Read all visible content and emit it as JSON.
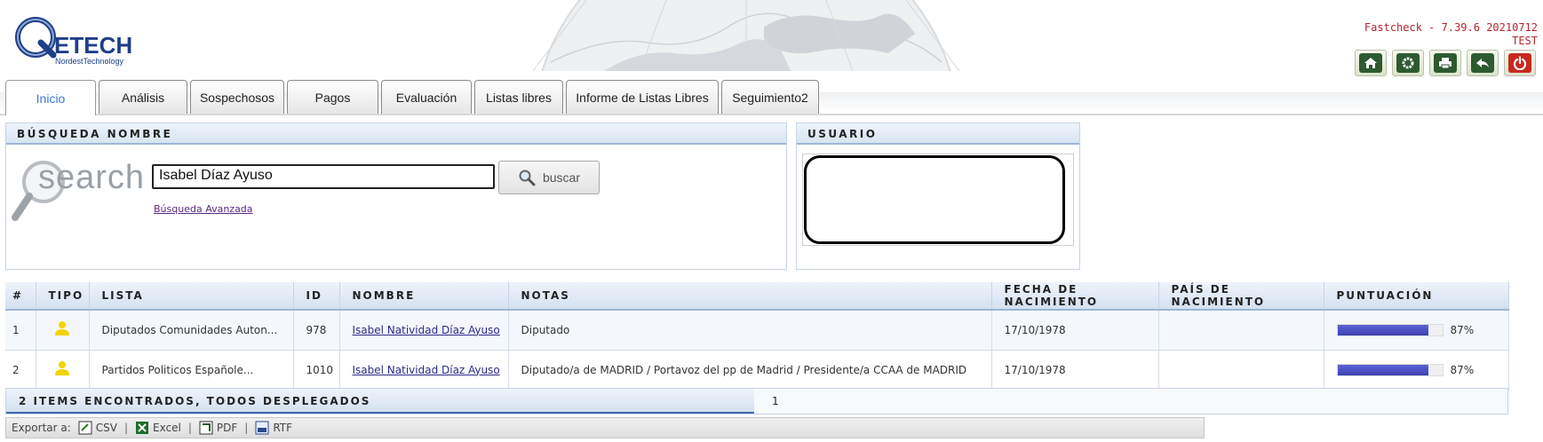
{
  "header": {
    "logo_text": "ETECH",
    "logo_sub": "NordestTechnology",
    "version": "Fastcheck - 7.39.6 20210712",
    "environment": "TEST",
    "toolbar": [
      {
        "icon": "home-icon"
      },
      {
        "icon": "gear-icon"
      },
      {
        "icon": "print-icon"
      },
      {
        "icon": "back-icon"
      },
      {
        "icon": "power-icon"
      }
    ]
  },
  "tabs": [
    {
      "label": "Inicio",
      "active": true
    },
    {
      "label": "Análisis"
    },
    {
      "label": "Sospechosos"
    },
    {
      "label": "Pagos"
    },
    {
      "label": "Evaluación"
    },
    {
      "label": "Listas libres"
    },
    {
      "label": "Informe de Listas Libres"
    },
    {
      "label": "Seguimiento2"
    }
  ],
  "search_panel": {
    "title": "BÚSQUEDA NOMBRE",
    "search_word": "search",
    "input_value": "Isabel Díaz Ayuso",
    "button_label": "buscar",
    "advanced_link": "Búsqueda Avanzada"
  },
  "user_panel": {
    "title": "USUARIO"
  },
  "results": {
    "headers": {
      "num": "#",
      "tipo": "TIPO",
      "lista": "LISTA",
      "id": "ID",
      "nombre": "NOMBRE",
      "notas": "NOTAS",
      "fecha": "FECHA DE NACIMIENTO",
      "pais": "PAÍS DE NACIMIENTO",
      "puntuacion": "PUNTUACIÓN"
    },
    "rows": [
      {
        "num": "1",
        "lista": "Diputados Comunidades Auton...",
        "id": "978",
        "nombre": "Isabel Natividad Díaz Ayuso",
        "notas": "Diputado",
        "fecha": "17/10/1978",
        "pais": "",
        "puntuacion": "87%",
        "score": 0.87
      },
      {
        "num": "2",
        "lista": "Partidos Politicos Españole...",
        "id": "1010",
        "nombre": "Isabel Natividad Díaz Ayuso",
        "notas": "Diputado/a de MADRID / Portavoz del pp de Madrid / Presidente/a CCAA de MADRID",
        "fecha": "17/10/1978",
        "pais": "",
        "puntuacion": "87%",
        "score": 0.87
      }
    ],
    "status": "2 ITEMS ENCONTRADOS, TODOS DESPLEGADOS",
    "page": "1"
  },
  "export": {
    "label": "Exportar a:",
    "items": [
      "CSV",
      "Excel",
      "PDF",
      "RTF"
    ],
    "separator": "|"
  },
  "colors": {
    "brand_blue": "#1f3f88",
    "version_red": "#b3262e",
    "score_bar": "#4a4fc4",
    "person_icon": "#f2d400"
  }
}
